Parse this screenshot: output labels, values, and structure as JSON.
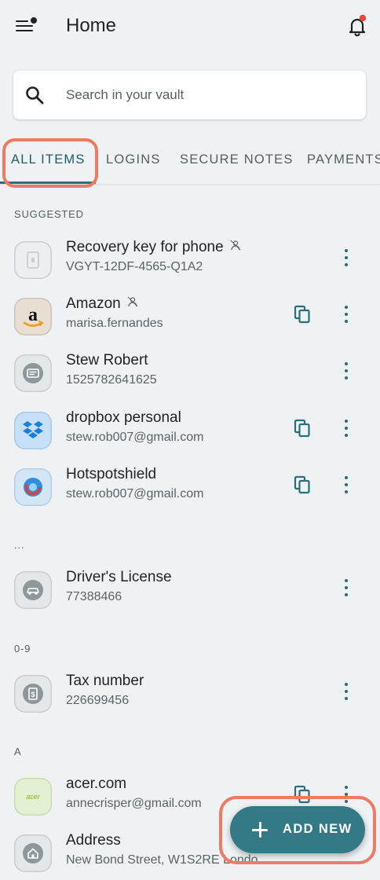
{
  "header": {
    "title": "Home",
    "menu_icon": "menu-with-notification-dot-icon",
    "bell_icon": "bell-alert-icon",
    "alert_color": "#e8473a"
  },
  "search": {
    "placeholder": "Search in your vault"
  },
  "tabs": [
    {
      "label": "ALL ITEMS",
      "active": true
    },
    {
      "label": "LOGINS"
    },
    {
      "label": "SECURE NOTES"
    },
    {
      "label": "PAYMENTS"
    }
  ],
  "sections": [
    {
      "label": "SUGGESTED"
    },
    {
      "label": "..."
    },
    {
      "label": "0-9"
    },
    {
      "label": "A"
    }
  ],
  "items": [
    {
      "name": "Recovery key for phone",
      "sub": "VGYT-12DF-4565-Q1A2",
      "icon": "document-key-icon",
      "shared": true,
      "copy": false
    },
    {
      "name": "Amazon",
      "sub": "marisa.fernandes",
      "icon": "amazon-logo-icon",
      "shared": true,
      "copy": true
    },
    {
      "name": "Stew Robert",
      "sub": "1525782641625",
      "icon": "id-card-icon",
      "shared": false,
      "copy": false
    },
    {
      "name": "dropbox personal",
      "sub": "stew.rob007@gmail.com",
      "icon": "dropbox-logo-icon",
      "shared": false,
      "copy": true
    },
    {
      "name": "Hotspotshield",
      "sub": "stew.rob007@gmail.com",
      "icon": "hotspotshield-logo-icon",
      "shared": false,
      "copy": true
    },
    {
      "name": "Driver's License",
      "sub": "77388466",
      "icon": "car-card-icon",
      "shared": false,
      "copy": false
    },
    {
      "name": "Tax number",
      "sub": "226699456",
      "icon": "tax-document-icon",
      "shared": false,
      "copy": false
    },
    {
      "name": "acer.com",
      "sub": "annecrisper@gmail.com",
      "icon": "acer-logo-icon",
      "logo_text": "acer",
      "shared": false,
      "copy": true
    },
    {
      "name": "Address",
      "sub": "New Bond Street, W1S2RE Londo...",
      "icon": "home-address-icon",
      "shared": false,
      "copy": false
    }
  ],
  "fab": {
    "label": "ADD NEW",
    "icon": "plus-icon"
  },
  "colors": {
    "accent": "#337a86",
    "highlight": "#ee7a64",
    "background": "#eef2f4"
  }
}
